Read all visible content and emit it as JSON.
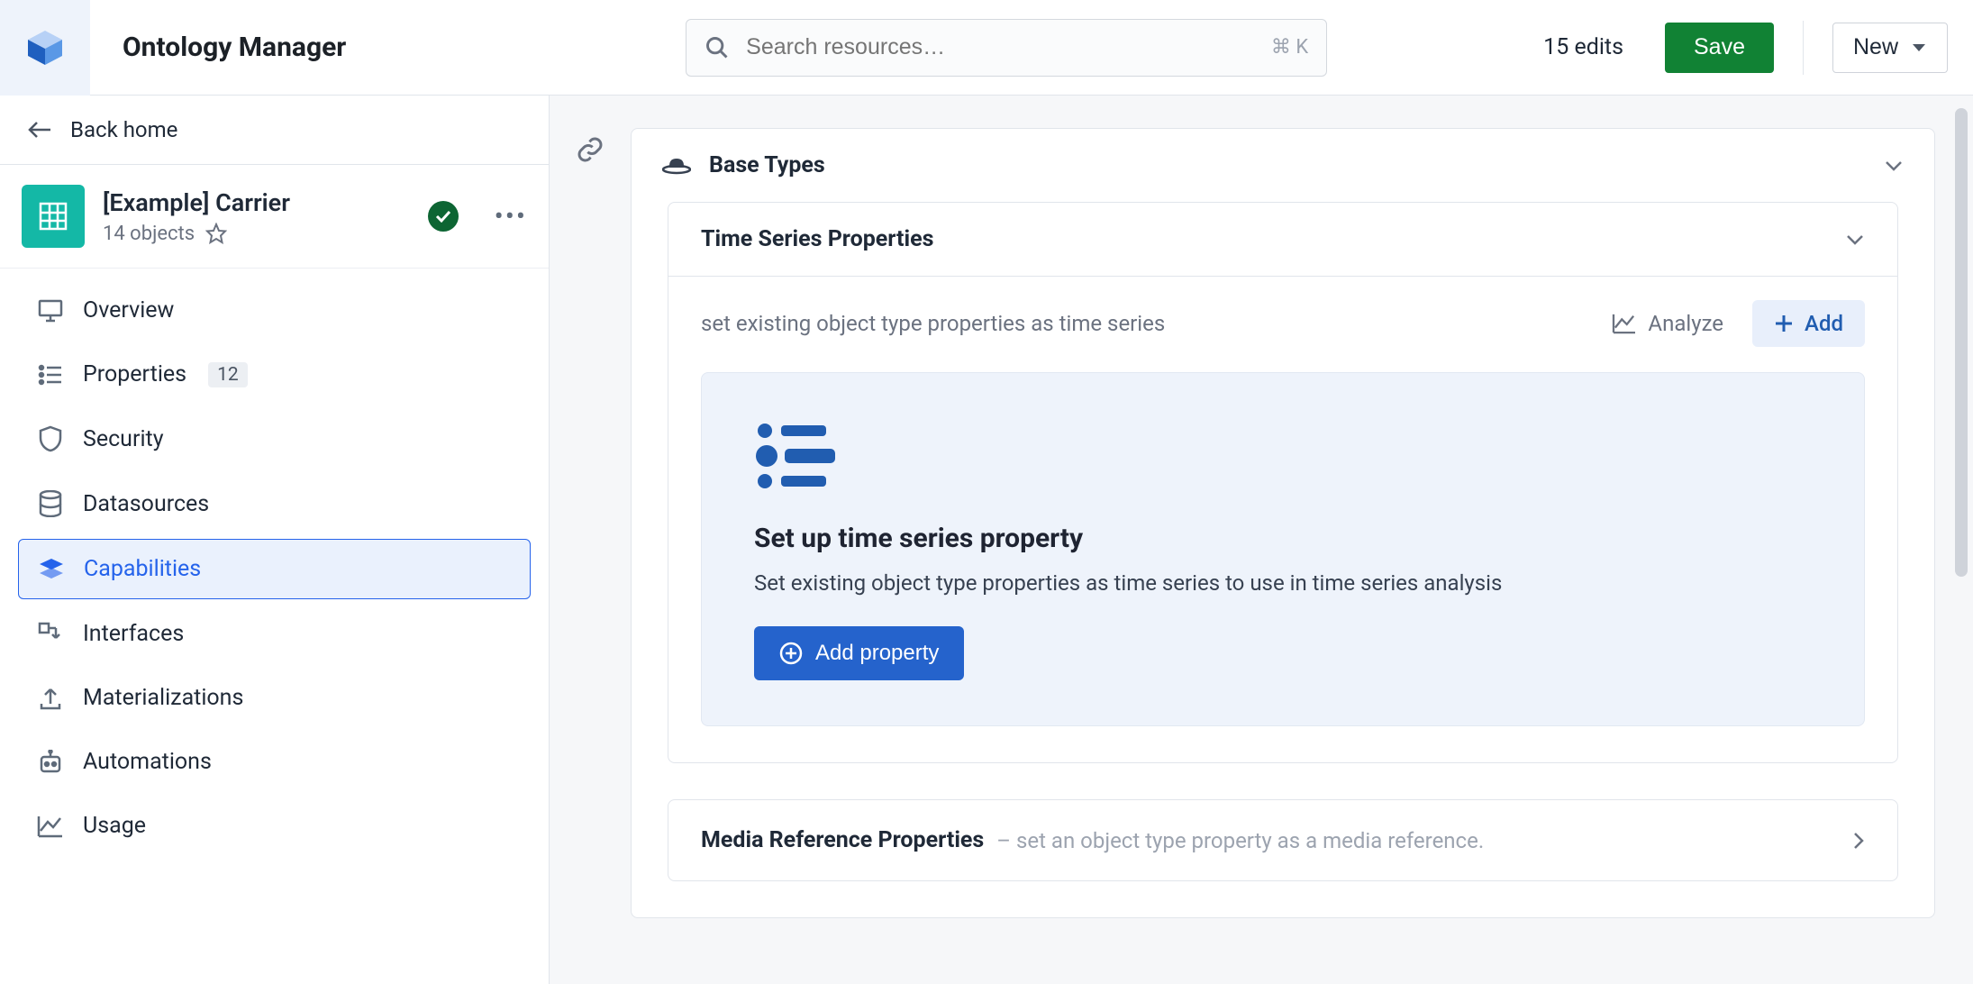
{
  "header": {
    "app_title": "Ontology Manager",
    "search_placeholder": "Search resources…",
    "shortcut": "⌘ K",
    "edits_text": "15 edits",
    "save_label": "Save",
    "new_label": "New"
  },
  "sidebar": {
    "back_label": "Back home",
    "object": {
      "title": "[Example] Carrier",
      "subtitle": "14 objects"
    },
    "nav": [
      {
        "id": "overview",
        "label": "Overview"
      },
      {
        "id": "properties",
        "label": "Properties",
        "badge": "12"
      },
      {
        "id": "security",
        "label": "Security"
      },
      {
        "id": "datasources",
        "label": "Datasources"
      },
      {
        "id": "capabilities",
        "label": "Capabilities",
        "selected": true
      },
      {
        "id": "interfaces",
        "label": "Interfaces"
      },
      {
        "id": "materializations",
        "label": "Materializations"
      },
      {
        "id": "automations",
        "label": "Automations"
      },
      {
        "id": "usage",
        "label": "Usage"
      }
    ]
  },
  "main": {
    "base_types_title": "Base Types",
    "ts_panel": {
      "title": "Time Series Properties",
      "desc": "set existing object type properties as time series",
      "analyze_label": "Analyze",
      "add_label": "Add",
      "setup_title": "Set up time series property",
      "setup_desc": "Set existing object type properties as time series to use in time series analysis",
      "add_property_label": "Add property"
    },
    "media_panel": {
      "title": "Media Reference Properties",
      "subtitle": "– set an object type property as a media reference."
    }
  }
}
